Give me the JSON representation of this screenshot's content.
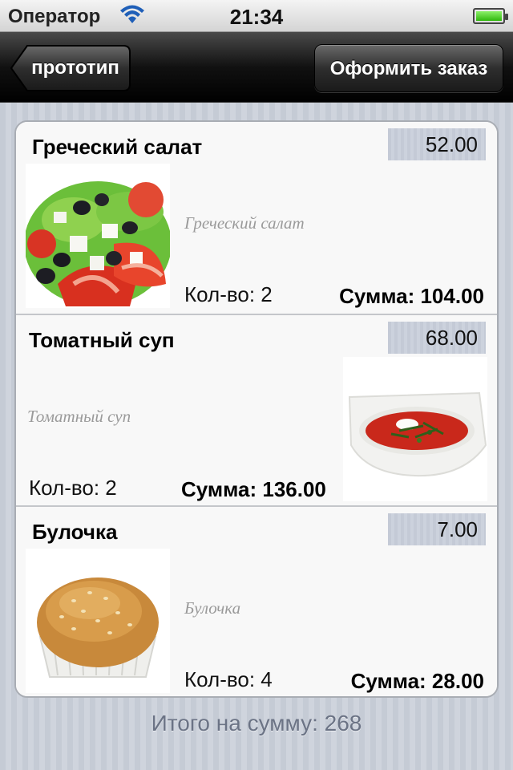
{
  "status_bar": {
    "carrier": "Оператор",
    "time": "21:34",
    "battery_level": 1.0
  },
  "nav": {
    "back_label": "прототип",
    "order_label": "Оформить заказ"
  },
  "items": [
    {
      "name": "Греческий салат",
      "price": "52.00",
      "description": "Греческий салат",
      "qty": "Кол-во: 2",
      "sum": "Сумма: 104.00",
      "image_icon": "greek-salad"
    },
    {
      "name": "Томатный суп",
      "price": "68.00",
      "description": "Томатный суп",
      "qty": "Кол-во: 2",
      "sum": "Сумма: 136.00",
      "image_icon": "tomato-soup"
    },
    {
      "name": "Булочка",
      "price": "7.00",
      "description": "Булочка",
      "qty": "Кол-во: 4",
      "sum": "Сумма: 28.00",
      "image_icon": "bun"
    }
  ],
  "total": "Итого на сумму: 268",
  "colors": {
    "nav_bg": "#000000",
    "page_bg": "#c7ccd6",
    "price_bg": "#c8ced9",
    "battery": "#2fb70c"
  }
}
